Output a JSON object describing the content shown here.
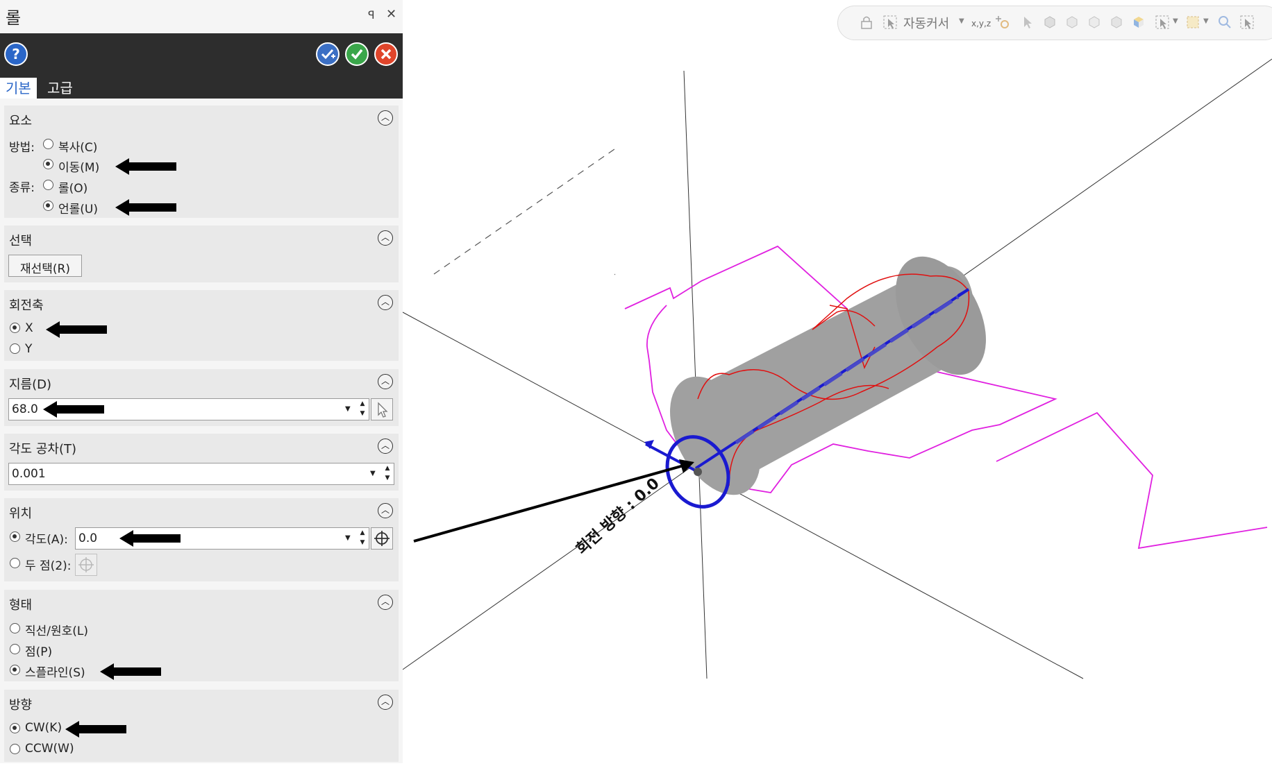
{
  "panel": {
    "title": "롤",
    "pin_glyph": "ꟼ",
    "close_glyph": "✕",
    "help_glyph": "?",
    "tabs": [
      "기본",
      "고급"
    ]
  },
  "sections": {
    "element": {
      "title": "요소",
      "method_label": "방법:",
      "method_copy": "복사(C)",
      "method_move": "이동(M)",
      "type_label": "종류:",
      "type_roll": "롤(O)",
      "type_unroll": "언롤(U)"
    },
    "selection": {
      "title": "선택",
      "reselect": "재선택(R)"
    },
    "axis": {
      "title": "회전축",
      "x": "X",
      "y": "Y"
    },
    "diameter": {
      "title": "지름(D)",
      "value": "68.0"
    },
    "tolerance": {
      "title": "각도 공차(T)",
      "value": "0.001"
    },
    "position": {
      "title": "위치",
      "angle_label": "각도(A):",
      "angle_value": "0.0",
      "two_points": "두 점(2):"
    },
    "shape": {
      "title": "형태",
      "line_arc": "직선/원호(L)",
      "point": "점(P)",
      "spline": "스플라인(S)"
    },
    "direction": {
      "title": "방향",
      "cw": "CW(K)",
      "ccw": "CCW(W)"
    }
  },
  "toolbar": {
    "cursor_label": "자동커서",
    "xyz": "x,y,z"
  },
  "viewport": {
    "rotation_label": "회전 방향 : 0.0"
  },
  "colors": {
    "dark_bar": "#2d2d2d",
    "accent": "#2a66c8",
    "cylinder": "#a0a0a0",
    "red_curve": "#e01010",
    "magenta_curve": "#e020e0",
    "axis_blue": "#1a1ad0"
  }
}
